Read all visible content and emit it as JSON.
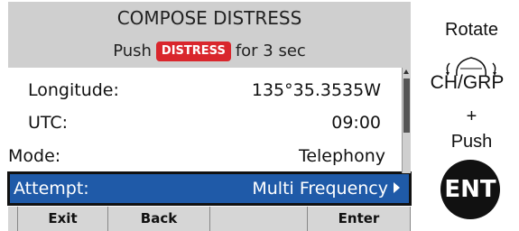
{
  "screen": {
    "title": "COMPOSE DISTRESS",
    "instruction": {
      "pre": "Push",
      "badge": "DISTRESS",
      "post": "for 3 sec"
    },
    "rows": [
      {
        "label": "Longitude:",
        "value": "135°35.3535W"
      },
      {
        "label": "UTC:",
        "value": "09:00"
      },
      {
        "label": "Mode:",
        "value": "Telephony"
      },
      {
        "label": "Attempt:",
        "value": "Multi Frequency"
      }
    ],
    "softkeys": {
      "exit": "Exit",
      "back": "Back",
      "blank": "",
      "enter": "Enter"
    }
  },
  "controls": {
    "rotate": "Rotate",
    "dial": "CH/GRP",
    "plus": "+",
    "push": "Push",
    "ent": "ENT"
  },
  "colors": {
    "badge": "#d9262c",
    "selection": "#1f5aa8",
    "header": "#cfcfcf"
  }
}
